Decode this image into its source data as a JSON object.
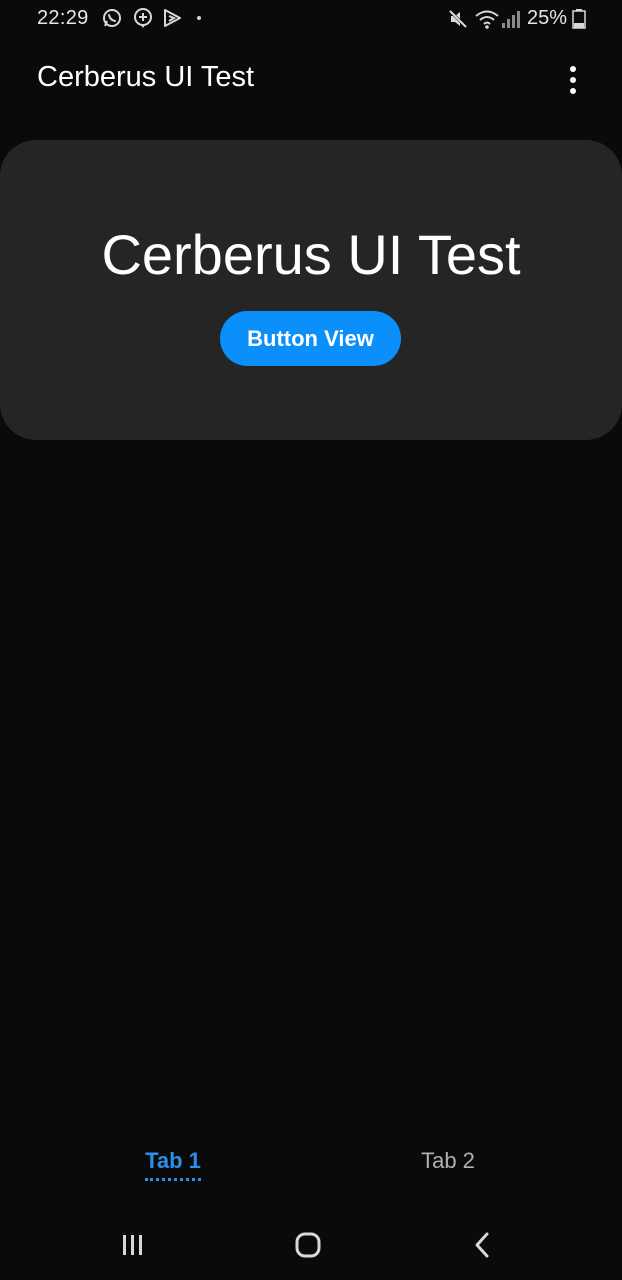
{
  "status_bar": {
    "time": "22:29",
    "notification_icons": [
      "whatsapp-icon",
      "messenger-plus-icon",
      "play-games-icon"
    ],
    "system_icons": [
      "mute-icon",
      "wifi-icon",
      "signal-icon",
      "battery-icon"
    ],
    "battery_percent": "25%"
  },
  "app_bar": {
    "title": "Cerberus UI Test",
    "menu_icon": "more-vert-icon"
  },
  "card": {
    "title": "Cerberus UI Test",
    "button_label": "Button View",
    "button_color": "#0a8ffb"
  },
  "tabs": [
    {
      "label": "Tab 1",
      "selected": true
    },
    {
      "label": "Tab 2",
      "selected": false
    }
  ],
  "nav_bar": {
    "buttons": [
      "recent-apps-icon",
      "home-icon",
      "back-icon"
    ]
  },
  "colors": {
    "background": "#0a0a0a",
    "card": "#252525",
    "accent": "#2e8de6"
  }
}
